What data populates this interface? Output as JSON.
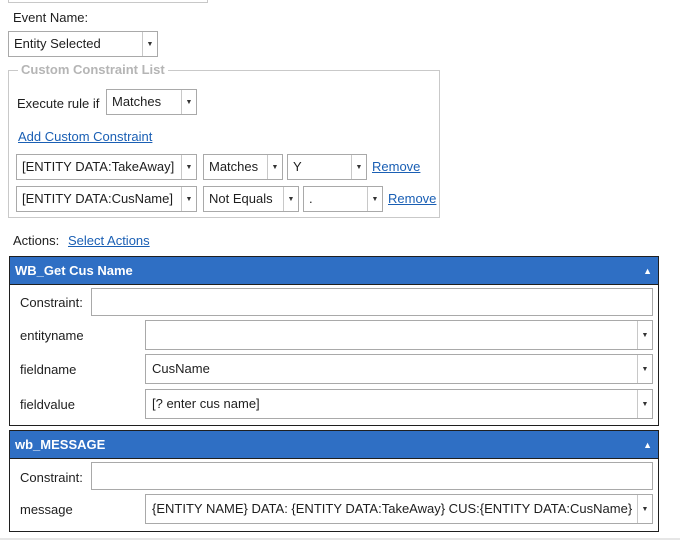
{
  "event": {
    "label": "Event Name:",
    "value": "Entity Selected"
  },
  "constraints": {
    "legend": "Custom Constraint List",
    "execute_label": "Execute rule if",
    "execute_value": "Matches",
    "add_link": "Add Custom Constraint",
    "rows": [
      {
        "field": "[ENTITY DATA:TakeAway]",
        "operator": "Matches",
        "value": "Y",
        "remove": "Remove"
      },
      {
        "field": "[ENTITY DATA:CusName]",
        "operator": "Not Equals",
        "value": ".",
        "remove": "Remove"
      }
    ]
  },
  "actions": {
    "label": "Actions:",
    "link": "Select Actions"
  },
  "panel1": {
    "title": "WB_Get Cus Name",
    "constraint_label": "Constraint:",
    "constraint_value": "",
    "rows": [
      {
        "label": "entityname",
        "value": ""
      },
      {
        "label": "fieldname",
        "value": "CusName"
      },
      {
        "label": "fieldvalue",
        "value": "[? enter cus name]"
      }
    ]
  },
  "panel2": {
    "title": "wb_MESSAGE",
    "constraint_label": "Constraint:",
    "constraint_value": "",
    "rows": [
      {
        "label": "message",
        "value": "{ENTITY NAME} DATA: {ENTITY DATA:TakeAway}  CUS:{ENTITY DATA:CusName}"
      }
    ]
  },
  "icons": {
    "dropdown": "chevron-down-icon",
    "collapse": "collapse-up-icon"
  },
  "colors": {
    "panel_header": "#2f6fc4",
    "link": "#1a5fb4",
    "legend": "#b5b5b5"
  }
}
